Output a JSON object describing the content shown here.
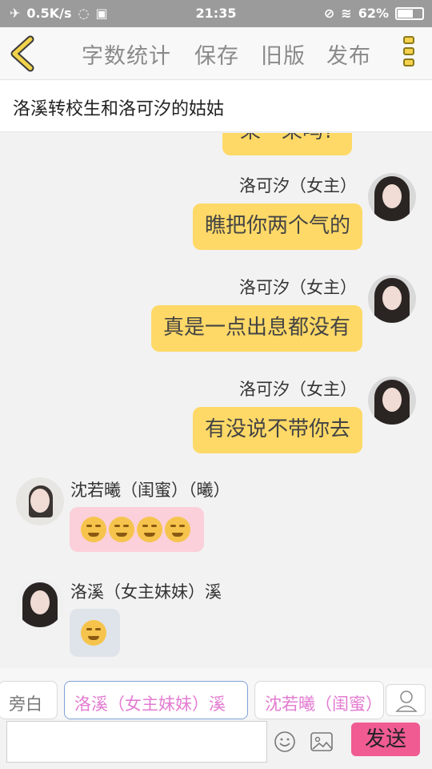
{
  "status_bar": {
    "net_speed": "0.5K/s",
    "time": "21:35",
    "battery": "62%",
    "battery_level": 0.62
  },
  "toolbar": {
    "word_count_label": "字数统计",
    "save_label": "保存",
    "old_version_label": "旧版",
    "publish_label": "发布"
  },
  "story": {
    "title": "洛溪转校生和洛可汐的姑姑"
  },
  "messages": [
    {
      "sender": "",
      "text": "呆一呆吗?",
      "side": "right"
    },
    {
      "sender": "洛可汐（女主）",
      "text": "瞧把你两个气的",
      "side": "right"
    },
    {
      "sender": "洛可汐（女主）",
      "text": "真是一点出息都没有",
      "side": "right"
    },
    {
      "sender": "洛可汐（女主）",
      "text": "有没说不带你去",
      "side": "right"
    },
    {
      "sender": "沈若曦（闺蜜）（曦）",
      "text": "",
      "side": "left",
      "sticker": "four-laughing-emoji"
    },
    {
      "sender": "洛溪（女主妹妹）溪",
      "text": "",
      "side": "left",
      "sticker": "wink-emoji"
    }
  ],
  "roles": [
    {
      "label": "旁白",
      "selected": false
    },
    {
      "label": "洛溪（女主妹妹）溪",
      "selected": true
    },
    {
      "label": "沈若曦（闺蜜）",
      "selected": false
    }
  ],
  "input": {
    "placeholder": "",
    "send_label": "发送"
  },
  "colors": {
    "bubble_right": "#fed967",
    "bubble_pink": "#fbd0da",
    "bubble_grey": "#dfe4ea",
    "send_button": "#f05b92",
    "role_text": "#e37bd1"
  }
}
